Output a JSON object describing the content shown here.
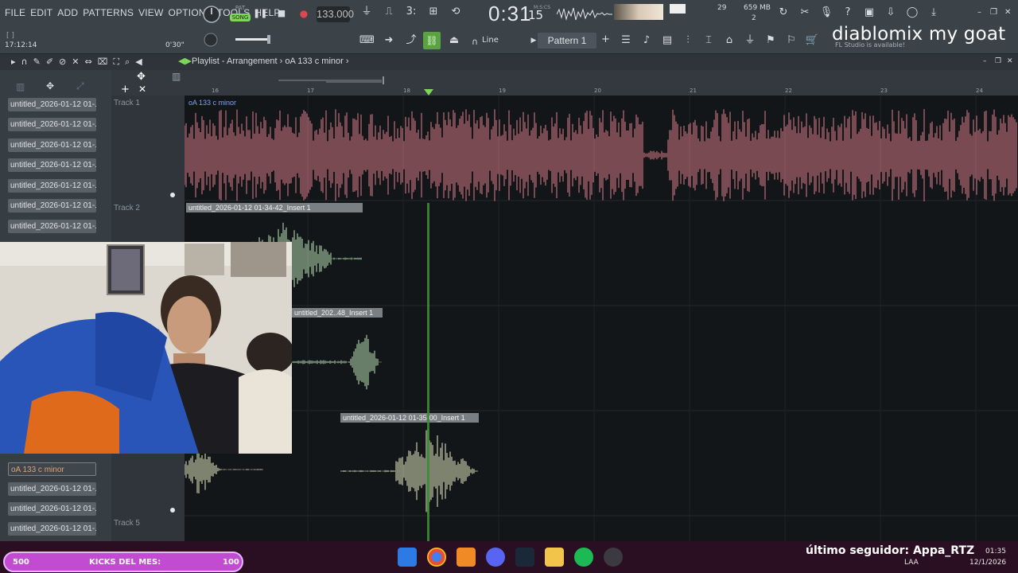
{
  "menu": [
    "FILE",
    "EDIT",
    "ADD",
    "PATTERNS",
    "VIEW",
    "OPTIONS",
    "TOOLS",
    "HELP"
  ],
  "transport": {
    "pat_label": "PAT",
    "song_label": "SONG",
    "tempo": "133.000",
    "time_main": "0:31",
    "time_sub": "15",
    "time_units": "M:S:CS"
  },
  "system": {
    "cpu": "29",
    "memory": "659 MB",
    "polyphony": "2"
  },
  "hint": {
    "clock": "17:12:14",
    "counter": "0'30\"",
    "brackets": "[ ]"
  },
  "toolbar": {
    "line_mode": "Line",
    "pattern": "Pattern 1",
    "plus": "+"
  },
  "overlay": {
    "stream_text": "diablomix my goat",
    "fl_news": "FL Studio is available!"
  },
  "playlist": {
    "breadcrumb": "Playlist - Arrangement",
    "current_clip": "oA 133 c minor",
    "ruler": [
      "16",
      "17",
      "18",
      "19",
      "20",
      "21",
      "22",
      "23",
      "24"
    ]
  },
  "channels": [
    "untitled_2026-01-12 01-...",
    "untitled_2026-01-12 01-...",
    "untitled_2026-01-12 01-...",
    "untitled_2026-01-12 01-...",
    "untitled_2026-01-12 01-...",
    "untitled_2026-01-12 01-...",
    "untitled_2026-01-12 01-...",
    "oA 133 c minor",
    "untitled_2026-01-12 01-...",
    "untitled_2026-01-12 01-...",
    "untitled_2026-01-12 01-..."
  ],
  "tracks": [
    "Track 1",
    "Track 2",
    "Track 5"
  ],
  "clips": {
    "c1": "oA 133 c minor",
    "c2": "untitled_2026-01-12 01-34-42_Insert 1",
    "c3": "untitled_202..48_Insert 1",
    "c4": "untitled_2026-01-12 01-35-00_Insert 1"
  },
  "taskbar": {
    "kicks_left": "500",
    "kicks_label": "KICKS DEL MES:",
    "kicks_right": "100",
    "follower": "último seguidor: Appa_RTZ",
    "lang": "LAA",
    "time": "01:35",
    "date": "12/1/2026"
  },
  "colors": {
    "accent_green": "#7ed65a",
    "record_red": "#e0464f",
    "waveform_pink": "#e07f8a",
    "waveform_green": "#bfe6b8"
  }
}
